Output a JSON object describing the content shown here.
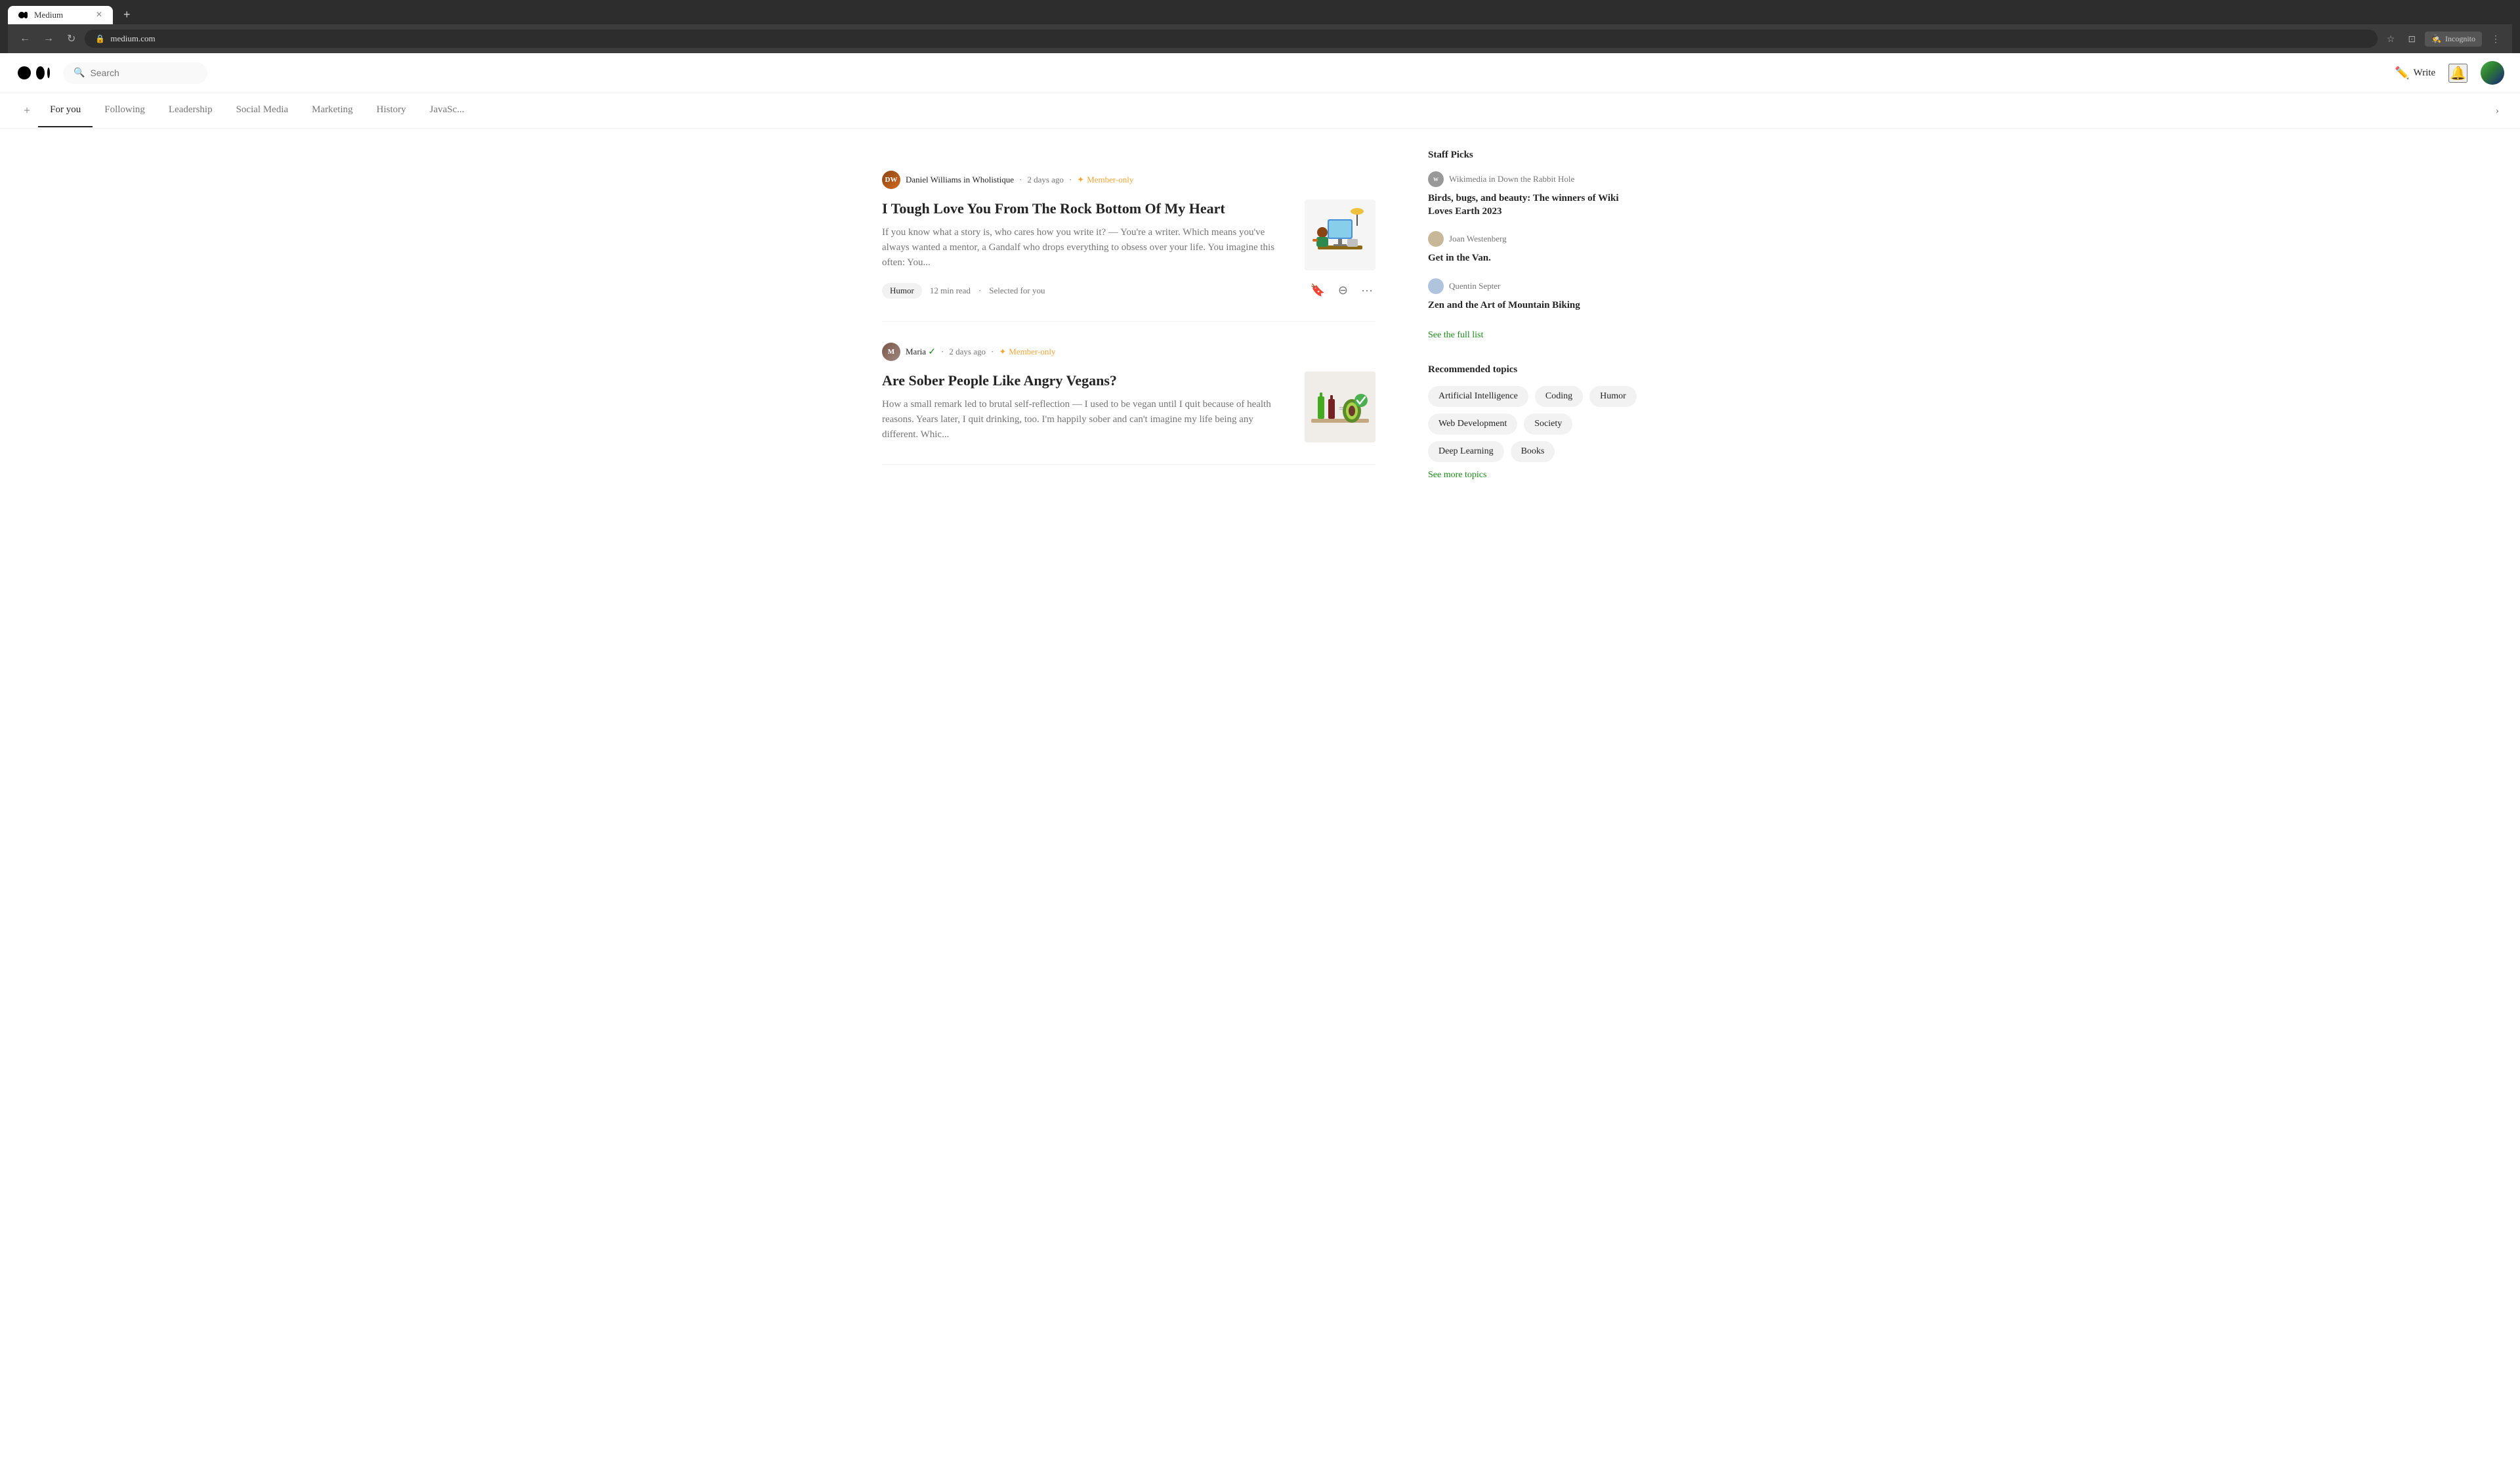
{
  "browser": {
    "tab_label": "Medium",
    "url": "medium.com",
    "incognito_label": "Incognito"
  },
  "header": {
    "logo_alt": "Medium",
    "search_placeholder": "Search",
    "write_label": "Write",
    "nav_tabs": [
      {
        "id": "add",
        "label": "+"
      },
      {
        "id": "for-you",
        "label": "For you",
        "active": true
      },
      {
        "id": "following",
        "label": "Following"
      },
      {
        "id": "leadership",
        "label": "Leadership"
      },
      {
        "id": "social-media",
        "label": "Social Media"
      },
      {
        "id": "marketing",
        "label": "Marketing"
      },
      {
        "id": "history",
        "label": "History"
      },
      {
        "id": "javascript",
        "label": "JavaSc..."
      }
    ]
  },
  "feed": {
    "articles": [
      {
        "id": "article-1",
        "author": "Daniel Williams",
        "publication": "Wholistique",
        "time_ago": "2 days ago",
        "member_only": true,
        "title": "I Tough Love You From The Rock Bottom Of My Heart",
        "excerpt": "If you know what a story is, who cares how you write it? — You're a writer. Which means you've always wanted a mentor, a Gandalf who drops everything to obsess over your life. You imagine this often: You...",
        "tag": "Humor",
        "read_time": "12 min read",
        "selected_for_you": true,
        "selected_label": "Selected for you"
      },
      {
        "id": "article-2",
        "author": "Maria",
        "publication": null,
        "time_ago": "2 days ago",
        "member_only": true,
        "verified": true,
        "title": "Are Sober People Like Angry Vegans?",
        "excerpt": "How a small remark led to brutal self-reflection — I used to be vegan until I quit because of health reasons. Years later, I quit drinking, too. I'm happily sober and can't imagine my life being any different. Whic...",
        "tag": null,
        "read_time": null,
        "selected_for_you": false
      }
    ]
  },
  "sidebar": {
    "staff_picks_title": "Staff Picks",
    "staff_picks": [
      {
        "id": "pick-1",
        "publication": "Wikimedia",
        "in_label": "in",
        "publication_section": "Down the Rabbit Hole",
        "title": "Birds, bugs, and beauty: The winners of Wiki Loves Earth 2023"
      },
      {
        "id": "pick-2",
        "author": "Joan Westenberg",
        "title": "Get in the Van."
      },
      {
        "id": "pick-3",
        "author": "Quentin Septer",
        "title": "Zen and the Art of Mountain Biking"
      }
    ],
    "see_full_list_label": "See the full list",
    "recommended_topics_title": "Recommended topics",
    "topics": [
      "Artificial Intelligence",
      "Coding",
      "Humor",
      "Web Development",
      "Society",
      "Deep Learning",
      "Books"
    ],
    "see_more_topics_label": "See more topics"
  }
}
